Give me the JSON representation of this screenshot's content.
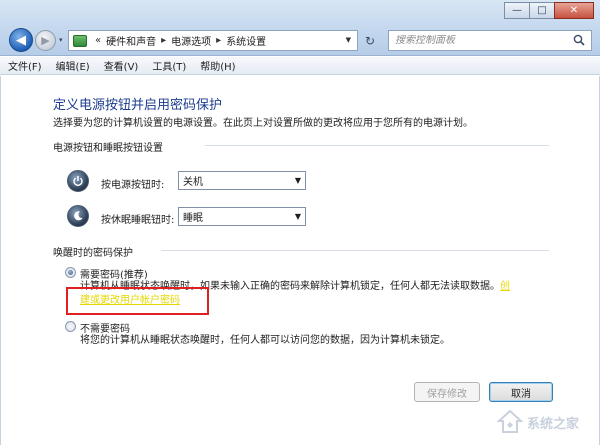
{
  "window": {
    "minimize_glyph": "—",
    "maximize_glyph": "□",
    "close_glyph": "✕"
  },
  "nav": {
    "back_glyph": "◀",
    "forward_glyph": "▶",
    "history_glyph": "▾"
  },
  "breadcrumb": {
    "overflow": "«",
    "items": [
      "硬件和声音",
      "电源选项",
      "系统设置"
    ]
  },
  "search": {
    "placeholder": "搜索控制面板"
  },
  "menu": {
    "items": [
      "文件(F)",
      "编辑(E)",
      "查看(V)",
      "工具(T)",
      "帮助(H)"
    ]
  },
  "page": {
    "title": "定义电源按钮并启用密码保护",
    "description": "选择要为您的计算机设置的电源设置。在此页上对设置所做的更改将应用于您所有的电源计划。"
  },
  "power_section": {
    "heading": "电源按钮和睡眠按钮设置",
    "power_button": {
      "label": "按电源按钮时:",
      "value": "关机"
    },
    "sleep_button": {
      "label": "按休眠睡眠钮时:",
      "value": "睡眠"
    }
  },
  "password_section": {
    "heading": "唤醒时的密码保护",
    "require": {
      "label": "需要密码(推荐)",
      "desc_line1": "计算机从睡眠状态唤醒时，如果未输入正确的密码来解除计算机锁定，任何人都无法读取数据。",
      "link_part1": "创",
      "link_part2": "建或更改用户帐户密码",
      "checked": true
    },
    "no_password": {
      "label": "不需要密码",
      "desc": "将您的计算机从睡眠状态唤醒时，任何人都可以访问您的数据，因为计算机未锁定。",
      "checked": false
    }
  },
  "buttons": {
    "save": "保存修改",
    "cancel": "取消"
  },
  "watermark": {
    "text": "系统之家"
  },
  "colors": {
    "title_blue": "#1c3d8f",
    "link_yellow": "#e4d800",
    "highlight_red": "#e02020"
  }
}
